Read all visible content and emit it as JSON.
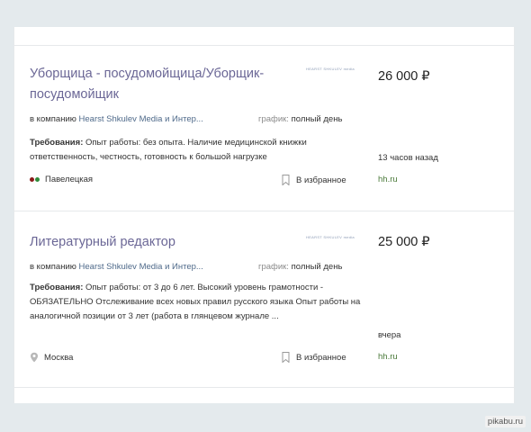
{
  "vacancies": [
    {
      "title": "Уборщица - посудомойщица/Уборщик-посудомойщик",
      "logo_text": "HEARST SHKULEV media",
      "salary": "26 000 ₽",
      "company_prefix": "в компанию",
      "company": "Hearst Shkulev Media и Интер...",
      "schedule_label": "график:",
      "schedule": "полный день",
      "requirements_label": "Требования:",
      "requirements": "Опыт работы: без опыта. Наличие медицинской книжки ответственность, честность, готовность к большой нагрузке",
      "posted": "13 часов назад",
      "location": "Павелецкая",
      "favorite_label": "В избранное",
      "source": "hh.ru"
    },
    {
      "title": "Литературный редактор",
      "logo_text": "HEARST SHKULEV media",
      "salary": "25 000 ₽",
      "company_prefix": "в компанию",
      "company": "Hearst Shkulev Media и Интер...",
      "schedule_label": "график:",
      "schedule": "полный день",
      "requirements_label": "Требования:",
      "requirements": "Опыт работы: от 3 до 6 лет. Высокий уровень грамотности - ОБЯЗАТЕЛЬНО Отслеживание всех новых правил русского языка Опыт работы на аналогичной позиции от 3 лет (работа в глянцевом журнале ...",
      "posted": "вчера",
      "location": "Москва",
      "favorite_label": "В избранное",
      "source": "hh.ru"
    }
  ],
  "metro_colors": [
    "#8b1a1a",
    "#2e8b3a"
  ],
  "watermark": "pikabu.ru"
}
